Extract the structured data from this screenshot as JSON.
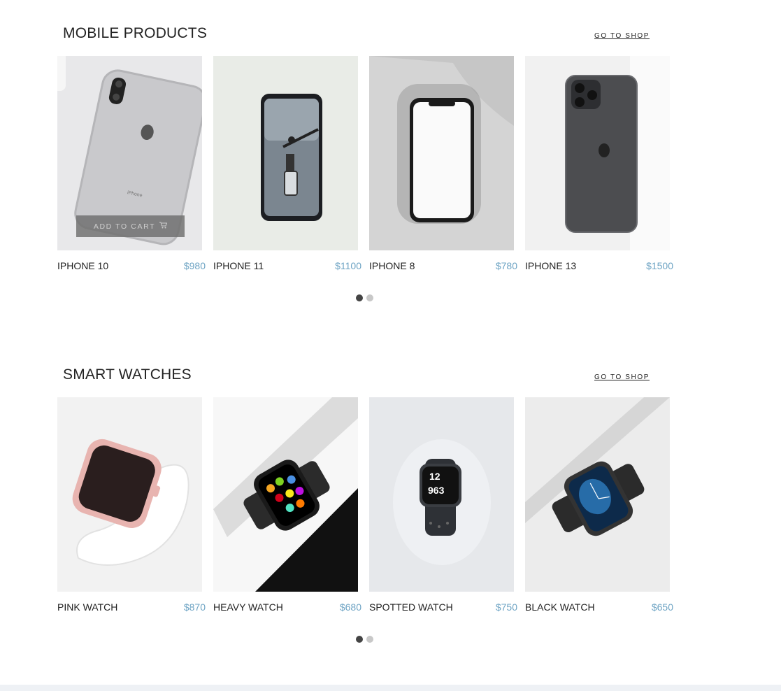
{
  "mobile": {
    "title": "MOBILE PRODUCTS",
    "shop_link": "GO TO SHOP",
    "add_to_cart_label": "ADD TO CART",
    "products": [
      {
        "name": "IPHONE 10",
        "price": "$980"
      },
      {
        "name": "IPHONE 11",
        "price": "$1100"
      },
      {
        "name": "IPHONE 8",
        "price": "$780"
      },
      {
        "name": "IPHONE 13",
        "price": "$1500"
      }
    ],
    "carousel": {
      "pages": 2,
      "active_page": 1
    }
  },
  "watches": {
    "title": "SMART WATCHES",
    "shop_link": "GO TO SHOP",
    "products": [
      {
        "name": "PINK WATCH",
        "price": "$870"
      },
      {
        "name": "HEAVY WATCH",
        "price": "$680"
      },
      {
        "name": "SPOTTED WATCH",
        "price": "$750"
      },
      {
        "name": "BLACK WATCH",
        "price": "$650"
      }
    ],
    "carousel": {
      "pages": 2,
      "active_page": 1
    }
  },
  "colors": {
    "price": "#6ea4c4",
    "dot_active": "#444444",
    "dot_inactive": "#c8c8c8"
  },
  "icons": {
    "cart": "cart-icon"
  }
}
